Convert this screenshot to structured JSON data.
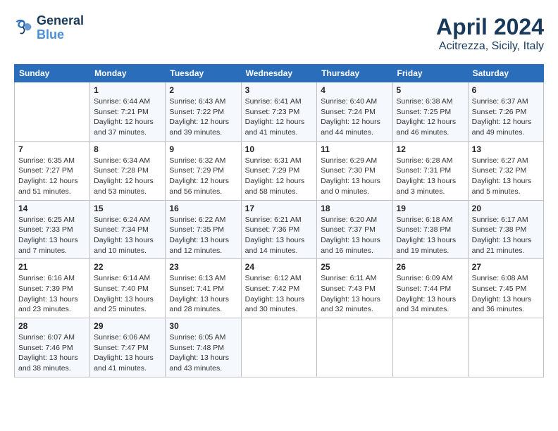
{
  "header": {
    "logo_line1": "General",
    "logo_line2": "Blue",
    "title": "April 2024",
    "subtitle": "Acitrezza, Sicily, Italy"
  },
  "weekdays": [
    "Sunday",
    "Monday",
    "Tuesday",
    "Wednesday",
    "Thursday",
    "Friday",
    "Saturday"
  ],
  "weeks": [
    [
      {
        "day": "",
        "sunrise": "",
        "sunset": "",
        "daylight": ""
      },
      {
        "day": "1",
        "sunrise": "6:44 AM",
        "sunset": "7:21 PM",
        "daylight": "12 hours and 37 minutes."
      },
      {
        "day": "2",
        "sunrise": "6:43 AM",
        "sunset": "7:22 PM",
        "daylight": "12 hours and 39 minutes."
      },
      {
        "day": "3",
        "sunrise": "6:41 AM",
        "sunset": "7:23 PM",
        "daylight": "12 hours and 41 minutes."
      },
      {
        "day": "4",
        "sunrise": "6:40 AM",
        "sunset": "7:24 PM",
        "daylight": "12 hours and 44 minutes."
      },
      {
        "day": "5",
        "sunrise": "6:38 AM",
        "sunset": "7:25 PM",
        "daylight": "12 hours and 46 minutes."
      },
      {
        "day": "6",
        "sunrise": "6:37 AM",
        "sunset": "7:26 PM",
        "daylight": "12 hours and 49 minutes."
      }
    ],
    [
      {
        "day": "7",
        "sunrise": "6:35 AM",
        "sunset": "7:27 PM",
        "daylight": "12 hours and 51 minutes."
      },
      {
        "day": "8",
        "sunrise": "6:34 AM",
        "sunset": "7:28 PM",
        "daylight": "12 hours and 53 minutes."
      },
      {
        "day": "9",
        "sunrise": "6:32 AM",
        "sunset": "7:29 PM",
        "daylight": "12 hours and 56 minutes."
      },
      {
        "day": "10",
        "sunrise": "6:31 AM",
        "sunset": "7:29 PM",
        "daylight": "12 hours and 58 minutes."
      },
      {
        "day": "11",
        "sunrise": "6:29 AM",
        "sunset": "7:30 PM",
        "daylight": "13 hours and 0 minutes."
      },
      {
        "day": "12",
        "sunrise": "6:28 AM",
        "sunset": "7:31 PM",
        "daylight": "13 hours and 3 minutes."
      },
      {
        "day": "13",
        "sunrise": "6:27 AM",
        "sunset": "7:32 PM",
        "daylight": "13 hours and 5 minutes."
      }
    ],
    [
      {
        "day": "14",
        "sunrise": "6:25 AM",
        "sunset": "7:33 PM",
        "daylight": "13 hours and 7 minutes."
      },
      {
        "day": "15",
        "sunrise": "6:24 AM",
        "sunset": "7:34 PM",
        "daylight": "13 hours and 10 minutes."
      },
      {
        "day": "16",
        "sunrise": "6:22 AM",
        "sunset": "7:35 PM",
        "daylight": "13 hours and 12 minutes."
      },
      {
        "day": "17",
        "sunrise": "6:21 AM",
        "sunset": "7:36 PM",
        "daylight": "13 hours and 14 minutes."
      },
      {
        "day": "18",
        "sunrise": "6:20 AM",
        "sunset": "7:37 PM",
        "daylight": "13 hours and 16 minutes."
      },
      {
        "day": "19",
        "sunrise": "6:18 AM",
        "sunset": "7:38 PM",
        "daylight": "13 hours and 19 minutes."
      },
      {
        "day": "20",
        "sunrise": "6:17 AM",
        "sunset": "7:38 PM",
        "daylight": "13 hours and 21 minutes."
      }
    ],
    [
      {
        "day": "21",
        "sunrise": "6:16 AM",
        "sunset": "7:39 PM",
        "daylight": "13 hours and 23 minutes."
      },
      {
        "day": "22",
        "sunrise": "6:14 AM",
        "sunset": "7:40 PM",
        "daylight": "13 hours and 25 minutes."
      },
      {
        "day": "23",
        "sunrise": "6:13 AM",
        "sunset": "7:41 PM",
        "daylight": "13 hours and 28 minutes."
      },
      {
        "day": "24",
        "sunrise": "6:12 AM",
        "sunset": "7:42 PM",
        "daylight": "13 hours and 30 minutes."
      },
      {
        "day": "25",
        "sunrise": "6:11 AM",
        "sunset": "7:43 PM",
        "daylight": "13 hours and 32 minutes."
      },
      {
        "day": "26",
        "sunrise": "6:09 AM",
        "sunset": "7:44 PM",
        "daylight": "13 hours and 34 minutes."
      },
      {
        "day": "27",
        "sunrise": "6:08 AM",
        "sunset": "7:45 PM",
        "daylight": "13 hours and 36 minutes."
      }
    ],
    [
      {
        "day": "28",
        "sunrise": "6:07 AM",
        "sunset": "7:46 PM",
        "daylight": "13 hours and 38 minutes."
      },
      {
        "day": "29",
        "sunrise": "6:06 AM",
        "sunset": "7:47 PM",
        "daylight": "13 hours and 41 minutes."
      },
      {
        "day": "30",
        "sunrise": "6:05 AM",
        "sunset": "7:48 PM",
        "daylight": "13 hours and 43 minutes."
      },
      {
        "day": "",
        "sunrise": "",
        "sunset": "",
        "daylight": ""
      },
      {
        "day": "",
        "sunrise": "",
        "sunset": "",
        "daylight": ""
      },
      {
        "day": "",
        "sunrise": "",
        "sunset": "",
        "daylight": ""
      },
      {
        "day": "",
        "sunrise": "",
        "sunset": "",
        "daylight": ""
      }
    ]
  ]
}
